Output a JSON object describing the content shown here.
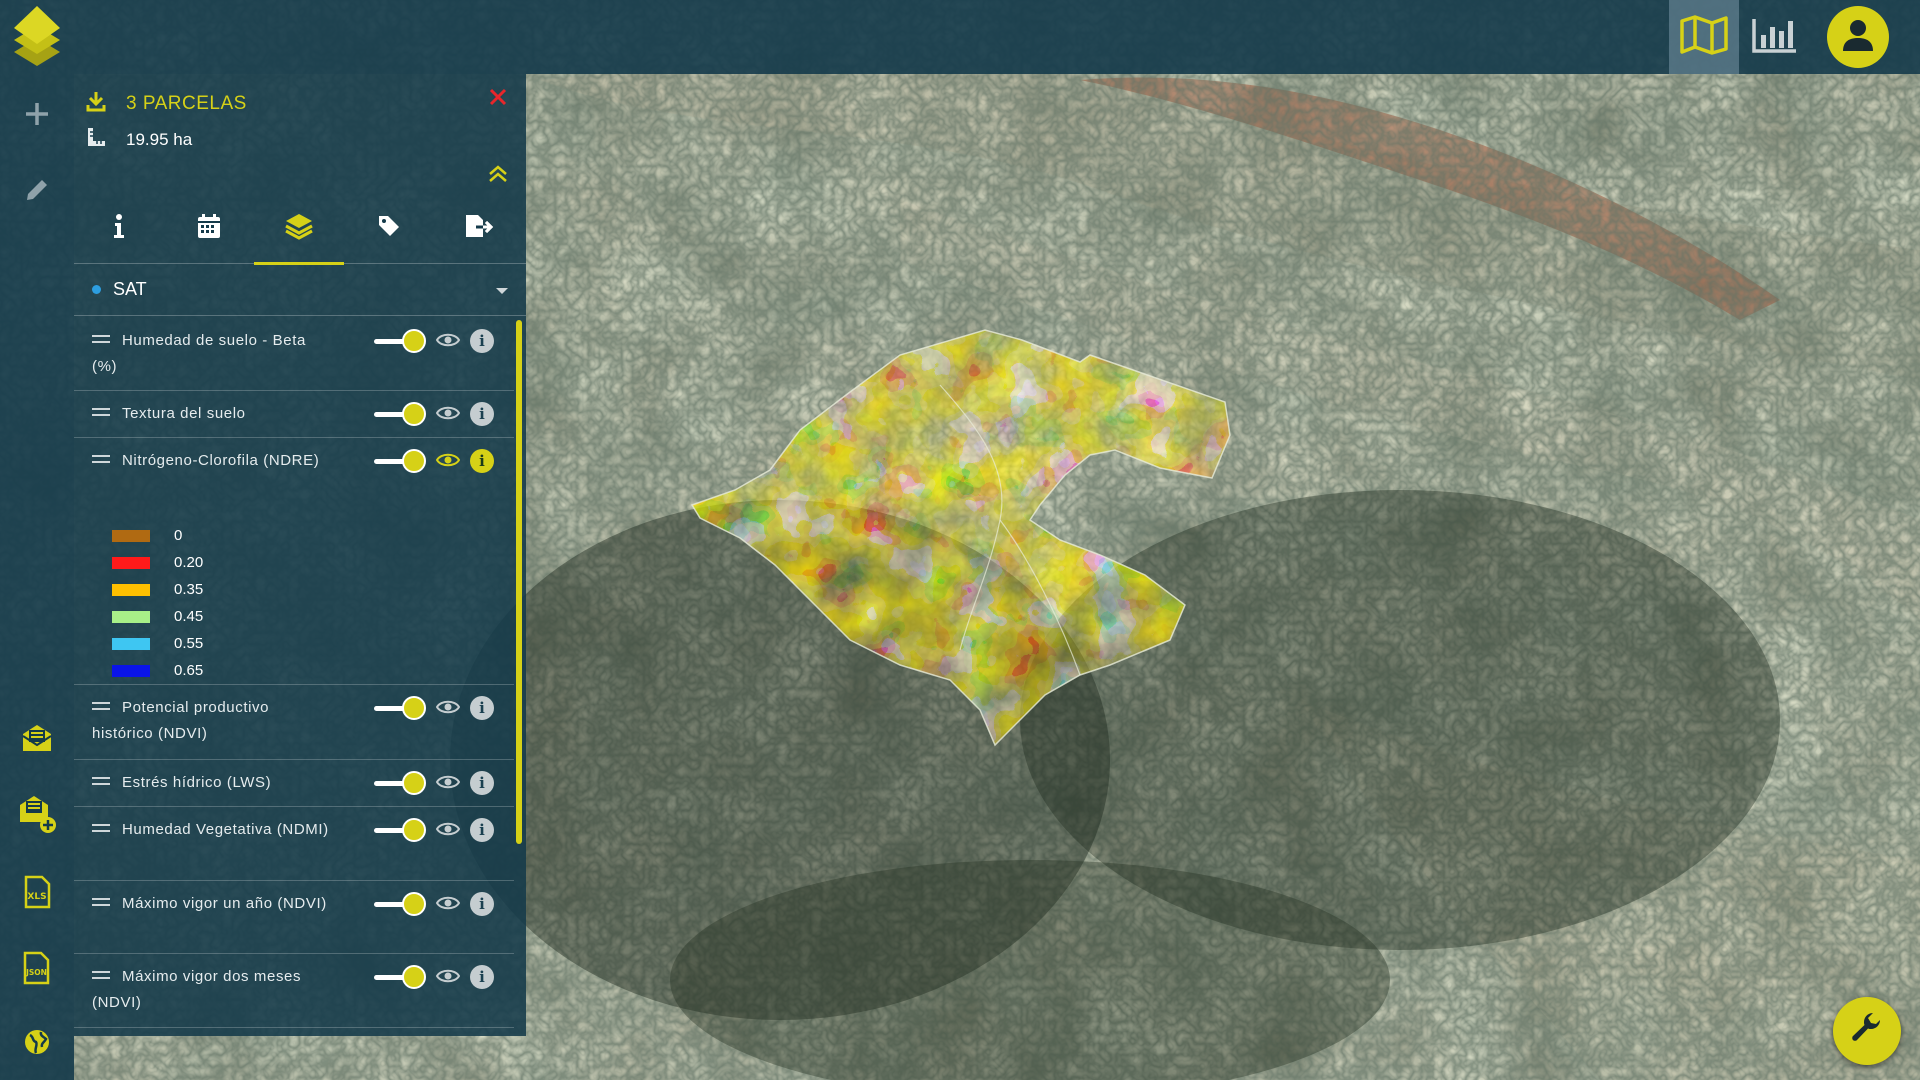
{
  "app": {
    "brand_color": "#d6d117",
    "panel_color": "#143a4a"
  },
  "topbar": {
    "tabs": [
      {
        "name": "map",
        "icon": "map-icon",
        "active": true
      },
      {
        "name": "stats",
        "icon": "bar-chart-icon",
        "active": false
      }
    ],
    "user_icon": "user-icon"
  },
  "leftrail": {
    "items": [
      {
        "icon": "plus-icon"
      },
      {
        "icon": "pencil-icon"
      },
      {
        "icon": "mail-icon"
      },
      {
        "icon": "mail-add-icon"
      },
      {
        "icon": "xls-file-icon"
      },
      {
        "icon": "json-file-icon"
      },
      {
        "icon": "globe-icon"
      }
    ]
  },
  "panel": {
    "title": "3 PARCELAS",
    "area": "19.95 ha",
    "tabs": [
      {
        "icon": "info-icon",
        "active": false
      },
      {
        "icon": "calendar-icon",
        "active": false
      },
      {
        "icon": "layers-icon",
        "active": true
      },
      {
        "icon": "tag-icon",
        "active": false
      },
      {
        "icon": "export-icon",
        "active": false
      }
    ],
    "source": "SAT",
    "layers": [
      {
        "name": "Humedad de suelo - Beta (%)",
        "enabled": true,
        "visible": false,
        "info_active": false
      },
      {
        "name": "Textura del suelo",
        "enabled": true,
        "visible": false,
        "info_active": false
      },
      {
        "name": "Nitrógeno-Clorofila (NDRE)",
        "enabled": true,
        "visible": true,
        "info_active": true
      },
      {
        "name": "Potencial productivo histórico (NDVI)",
        "enabled": true,
        "visible": false,
        "info_active": false
      },
      {
        "name": "Estrés hídrico (LWS)",
        "enabled": true,
        "visible": false,
        "info_active": false
      },
      {
        "name": "Humedad Vegetativa (NDMI)",
        "enabled": true,
        "visible": false,
        "info_active": false
      },
      {
        "name": "Máximo vigor un año (NDVI)",
        "enabled": true,
        "visible": false,
        "info_active": false
      },
      {
        "name": "Máximo vigor dos meses (NDVI)",
        "enabled": true,
        "visible": false,
        "info_active": false
      }
    ],
    "legend": [
      {
        "value": "0",
        "color": "#b06a12"
      },
      {
        "value": "0.20",
        "color": "#ff1a1a"
      },
      {
        "value": "0.35",
        "color": "#ffc000"
      },
      {
        "value": "0.45",
        "color": "#a8f088"
      },
      {
        "value": "0.55",
        "color": "#3ec6f2"
      },
      {
        "value": "0.65",
        "color": "#0a14e8"
      }
    ]
  },
  "tools_button_icon": "wrench-icon"
}
